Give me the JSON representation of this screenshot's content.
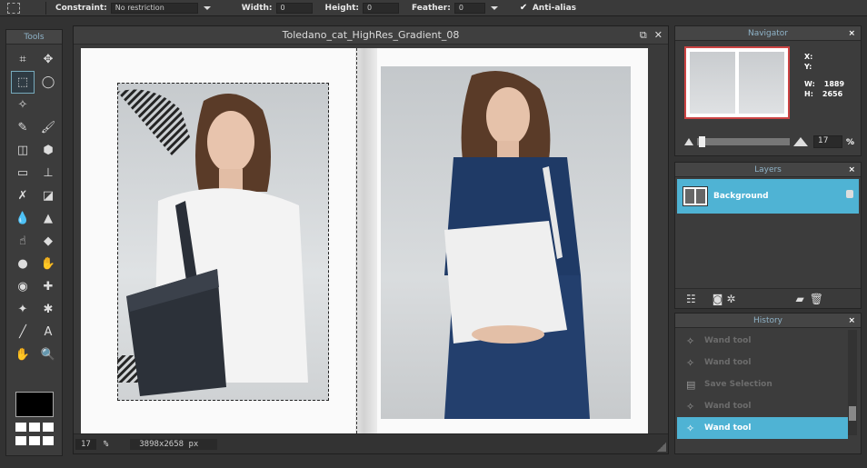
{
  "options_bar": {
    "constraint_label": "Constraint:",
    "constraint_value": "No restriction",
    "width_label": "Width:",
    "width_value": "0",
    "height_label": "Height:",
    "height_value": "0",
    "feather_label": "Feather:",
    "feather_value": "0",
    "antialias_label": "Anti-alias",
    "antialias_checked": true
  },
  "tools": {
    "title": "Tools",
    "items": [
      {
        "name": "crop-tool",
        "glyph": "⌗"
      },
      {
        "name": "move-tool",
        "glyph": "✥"
      },
      {
        "name": "marquee-tool",
        "glyph": "⬚",
        "selected": true
      },
      {
        "name": "lasso-tool",
        "glyph": "◯"
      },
      {
        "name": "magic-wand-tool",
        "glyph": "✧"
      },
      {
        "name": "blank",
        "glyph": ""
      },
      {
        "name": "pencil-tool",
        "glyph": "✎"
      },
      {
        "name": "brush-tool",
        "glyph": "🖌"
      },
      {
        "name": "eraser-tool",
        "glyph": "◫"
      },
      {
        "name": "paint-bucket-tool",
        "glyph": "⬢"
      },
      {
        "name": "gradient-tool",
        "glyph": "▭"
      },
      {
        "name": "stamp-tool",
        "glyph": "⊥"
      },
      {
        "name": "color-replace-tool",
        "glyph": "✗"
      },
      {
        "name": "drawing-tool",
        "glyph": "◪"
      },
      {
        "name": "blur-tool",
        "glyph": "💧"
      },
      {
        "name": "sharpen-tool",
        "glyph": "▲"
      },
      {
        "name": "smudge-tool",
        "glyph": "☝"
      },
      {
        "name": "sponge-tool",
        "glyph": "◆"
      },
      {
        "name": "dodge-tool",
        "glyph": "●"
      },
      {
        "name": "burn-tool",
        "glyph": "✋"
      },
      {
        "name": "red-eye-tool",
        "glyph": "◉"
      },
      {
        "name": "spot-heal-tool",
        "glyph": "✚"
      },
      {
        "name": "bloat-tool",
        "glyph": "✦"
      },
      {
        "name": "pinch-tool",
        "glyph": "✱"
      },
      {
        "name": "color-picker-tool",
        "glyph": "╱"
      },
      {
        "name": "type-tool",
        "glyph": "A"
      },
      {
        "name": "hand-tool",
        "glyph": "✋"
      },
      {
        "name": "zoom-tool",
        "glyph": "🔍"
      }
    ]
  },
  "document": {
    "title": "Toledano_cat_HighRes_Gradient_08",
    "zoom": "17",
    "zoom_unit": "%",
    "dimensions": "3898x2658 px"
  },
  "navigator": {
    "title": "Navigator",
    "x_label": "X:",
    "y_label": "Y:",
    "w_label": "W:",
    "w_value": "1889",
    "h_label": "H:",
    "h_value": "2656",
    "zoom": "17",
    "zoom_unit": "%"
  },
  "layers": {
    "title": "Layers",
    "items": [
      {
        "name": "Background"
      }
    ]
  },
  "history": {
    "title": "History",
    "items": [
      {
        "label": "Wand tool"
      },
      {
        "label": "Wand tool"
      },
      {
        "label": "Save Selection"
      },
      {
        "label": "Wand tool"
      },
      {
        "label": "Wand tool",
        "selected": true
      }
    ]
  },
  "colors": {
    "accent": "#4fb3d4",
    "panel_title": "#8fb3c8"
  }
}
